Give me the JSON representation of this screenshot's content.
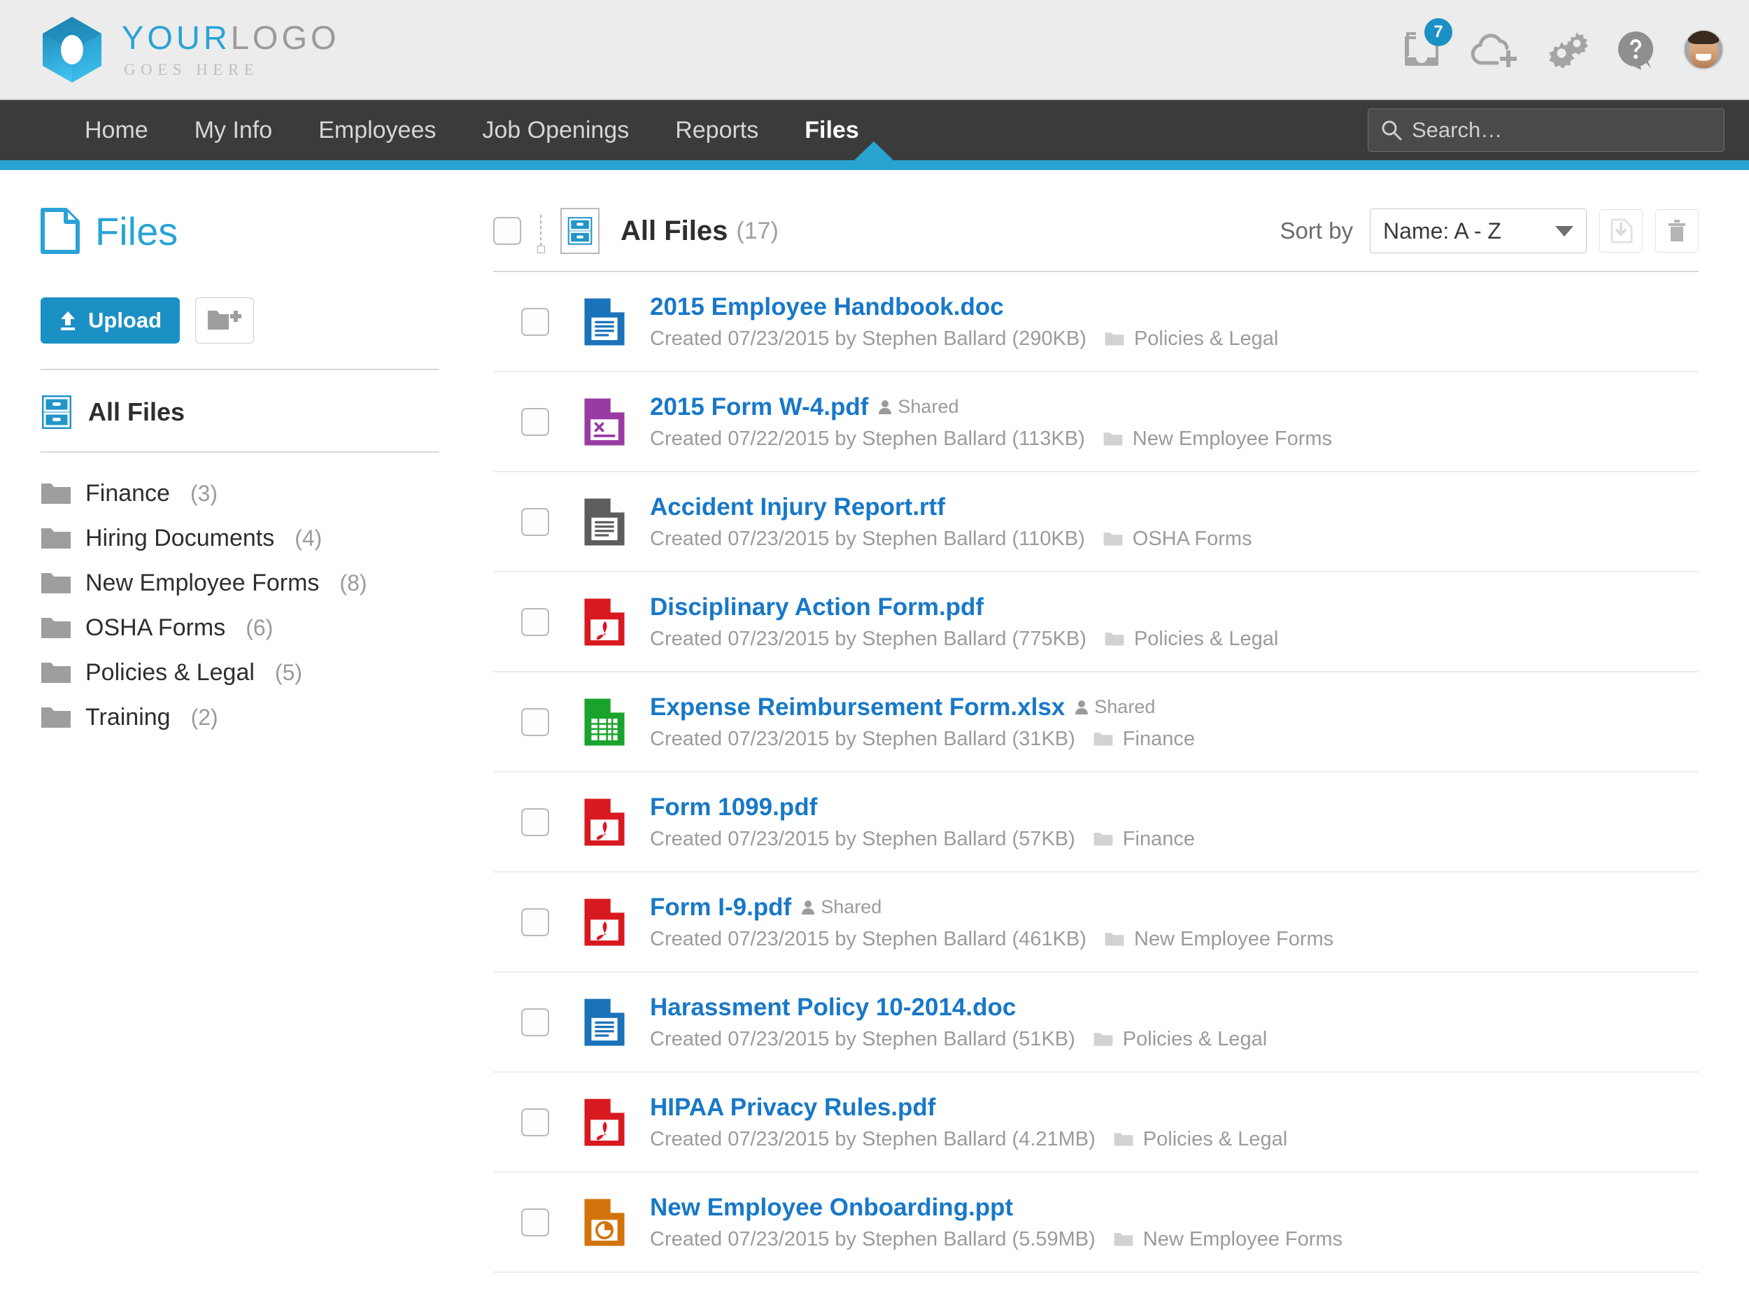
{
  "brand": {
    "line1_bold": "YOUR",
    "line1_light": "LOGO",
    "line2": "GOES HERE"
  },
  "topbar": {
    "inbox_badge": "7",
    "icons": [
      "inbox-icon",
      "cloud-add-icon",
      "gears-icon",
      "help-icon",
      "avatar"
    ]
  },
  "nav": {
    "items": [
      {
        "label": "Home",
        "active": false
      },
      {
        "label": "My Info",
        "active": false
      },
      {
        "label": "Employees",
        "active": false
      },
      {
        "label": "Job Openings",
        "active": false
      },
      {
        "label": "Reports",
        "active": false
      },
      {
        "label": "Files",
        "active": true
      }
    ],
    "search_placeholder": "Search…"
  },
  "page": {
    "title": "Files"
  },
  "sidebar": {
    "upload_label": "Upload",
    "new_folder_label": "",
    "all_files_label": "All Files",
    "folders": [
      {
        "name": "Finance",
        "count": "(3)"
      },
      {
        "name": "Hiring Documents",
        "count": "(4)"
      },
      {
        "name": "New Employee Forms",
        "count": "(8)"
      },
      {
        "name": "OSHA Forms",
        "count": "(6)"
      },
      {
        "name": "Policies & Legal",
        "count": "(5)"
      },
      {
        "name": "Training",
        "count": "(2)"
      }
    ]
  },
  "filelist": {
    "header_title": "All Files",
    "header_count": "(17)",
    "sort_label": "Sort by",
    "sort_value": "Name: A - Z",
    "files": [
      {
        "name": "2015 Employee Handbook.doc",
        "type": "doc",
        "shared": "",
        "created": "Created 07/23/2015 by Stephen Ballard (290KB)",
        "folder": "Policies & Legal"
      },
      {
        "name": "2015 Form W-4.pdf",
        "type": "form",
        "shared": "Shared",
        "created": "Created 07/22/2015 by Stephen Ballard (113KB)",
        "folder": "New Employee Forms"
      },
      {
        "name": "Accident Injury Report.rtf",
        "type": "rtf",
        "shared": "",
        "created": "Created 07/23/2015 by Stephen Ballard (110KB)",
        "folder": "OSHA Forms"
      },
      {
        "name": "Disciplinary Action Form.pdf",
        "type": "pdf",
        "shared": "",
        "created": "Created 07/23/2015 by Stephen Ballard (775KB)",
        "folder": "Policies & Legal"
      },
      {
        "name": "Expense Reimbursement Form.xlsx",
        "type": "xlsx",
        "shared": "Shared",
        "created": "Created 07/23/2015 by Stephen Ballard (31KB)",
        "folder": "Finance"
      },
      {
        "name": "Form 1099.pdf",
        "type": "pdf",
        "shared": "",
        "created": "Created 07/23/2015 by Stephen Ballard (57KB)",
        "folder": "Finance"
      },
      {
        "name": "Form I-9.pdf",
        "type": "pdf",
        "shared": "Shared",
        "created": "Created 07/23/2015 by Stephen Ballard (461KB)",
        "folder": "New Employee Forms"
      },
      {
        "name": "Harassment Policy 10-2014.doc",
        "type": "doc",
        "shared": "",
        "created": "Created 07/23/2015 by Stephen Ballard (51KB)",
        "folder": "Policies & Legal"
      },
      {
        "name": "HIPAA Privacy Rules.pdf",
        "type": "pdf",
        "shared": "",
        "created": "Created 07/23/2015 by Stephen Ballard (4.21MB)",
        "folder": "Policies & Legal"
      },
      {
        "name": "New Employee Onboarding.ppt",
        "type": "ppt",
        "shared": "",
        "created": "Created 07/23/2015 by Stephen Ballard (5.59MB)",
        "folder": "New Employee Forms"
      }
    ]
  },
  "colors": {
    "brand_blue": "#29a3d6",
    "accent_blue": "#1b90c4",
    "nav_dark": "#3b3b3b",
    "stripe_blue": "#29a3cf",
    "link_blue": "#1878c8",
    "doc_blue": "#1a72b8",
    "pdf_red": "#d8191f",
    "xlsx_green": "#1aa32c",
    "ppt_orange": "#d2740b",
    "form_purple": "#9a3ba3",
    "rtf_gray": "#5d5d5d"
  }
}
